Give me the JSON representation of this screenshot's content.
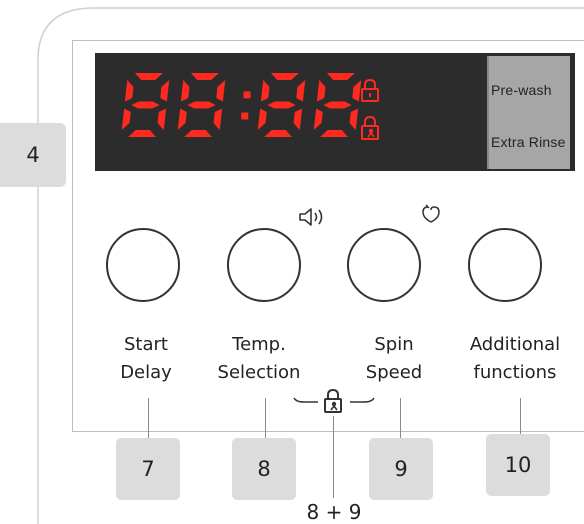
{
  "display": {
    "digits": "88:88",
    "side_labels": [
      "Pre-wash",
      "Extra Rinse"
    ]
  },
  "buttons": [
    {
      "line1": "Start",
      "line2": "Delay",
      "callout": "7"
    },
    {
      "line1": "Temp.",
      "line2": "Selection",
      "callout": "8"
    },
    {
      "line1": "Spin",
      "line2": "Speed",
      "callout": "9"
    },
    {
      "line1": "Additional",
      "line2": "functions",
      "callout": "10"
    }
  ],
  "left_callout": "4",
  "combo_label": "8 + 9",
  "icons": [
    "lock-icon",
    "child-lock-icon",
    "sound-icon",
    "hand-care-icon"
  ],
  "colors": {
    "segment_red": "#ff2a1f",
    "display_bg": "#2c2c2c",
    "callout_bg": "#dcdcdc"
  }
}
